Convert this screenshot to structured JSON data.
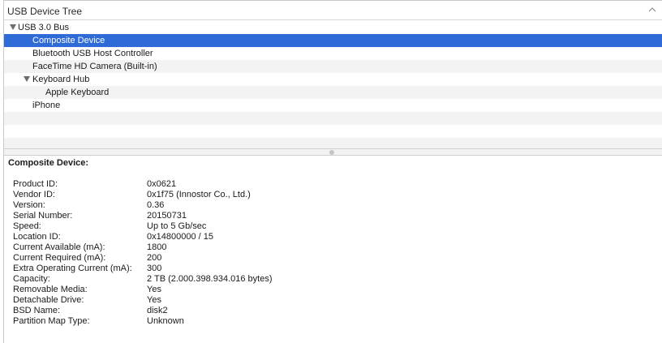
{
  "header": {
    "title": "USB Device Tree",
    "collapse_icon": "chevron-up-icon"
  },
  "tree": [
    {
      "label": "USB 3.0 Bus",
      "expanded": true
    },
    {
      "label": "Composite Device",
      "selected": true
    },
    {
      "label": "Bluetooth USB Host Controller"
    },
    {
      "label": "FaceTime HD Camera (Built-in)"
    },
    {
      "label": "Keyboard Hub",
      "expanded": true
    },
    {
      "label": "Apple Keyboard"
    },
    {
      "label": "iPhone"
    }
  ],
  "details": {
    "heading": "Composite Device:",
    "properties": [
      {
        "name": "Product ID:",
        "value": "0x0621"
      },
      {
        "name": "Vendor ID:",
        "value": "0x1f75  (Innostor Co., Ltd.)"
      },
      {
        "name": "Version:",
        "value": "0.36"
      },
      {
        "name": "Serial Number:",
        "value": "20150731"
      },
      {
        "name": "Speed:",
        "value": "Up to 5 Gb/sec"
      },
      {
        "name": "Location ID:",
        "value": "0x14800000 / 15"
      },
      {
        "name": "Current Available (mA):",
        "value": "1800"
      },
      {
        "name": "Current Required (mA):",
        "value": "200"
      },
      {
        "name": "Extra Operating Current (mA):",
        "value": "300"
      },
      {
        "name": "Capacity:",
        "value": "2 TB (2.000.398.934.016 bytes)"
      },
      {
        "name": "Removable Media:",
        "value": "Yes"
      },
      {
        "name": "Detachable Drive:",
        "value": "Yes"
      },
      {
        "name": "BSD Name:",
        "value": "disk2"
      },
      {
        "name": "Partition Map Type:",
        "value": "Unknown"
      }
    ]
  },
  "colors": {
    "selection": "#2f6bd6",
    "alt_row": "#f3f3f3"
  }
}
